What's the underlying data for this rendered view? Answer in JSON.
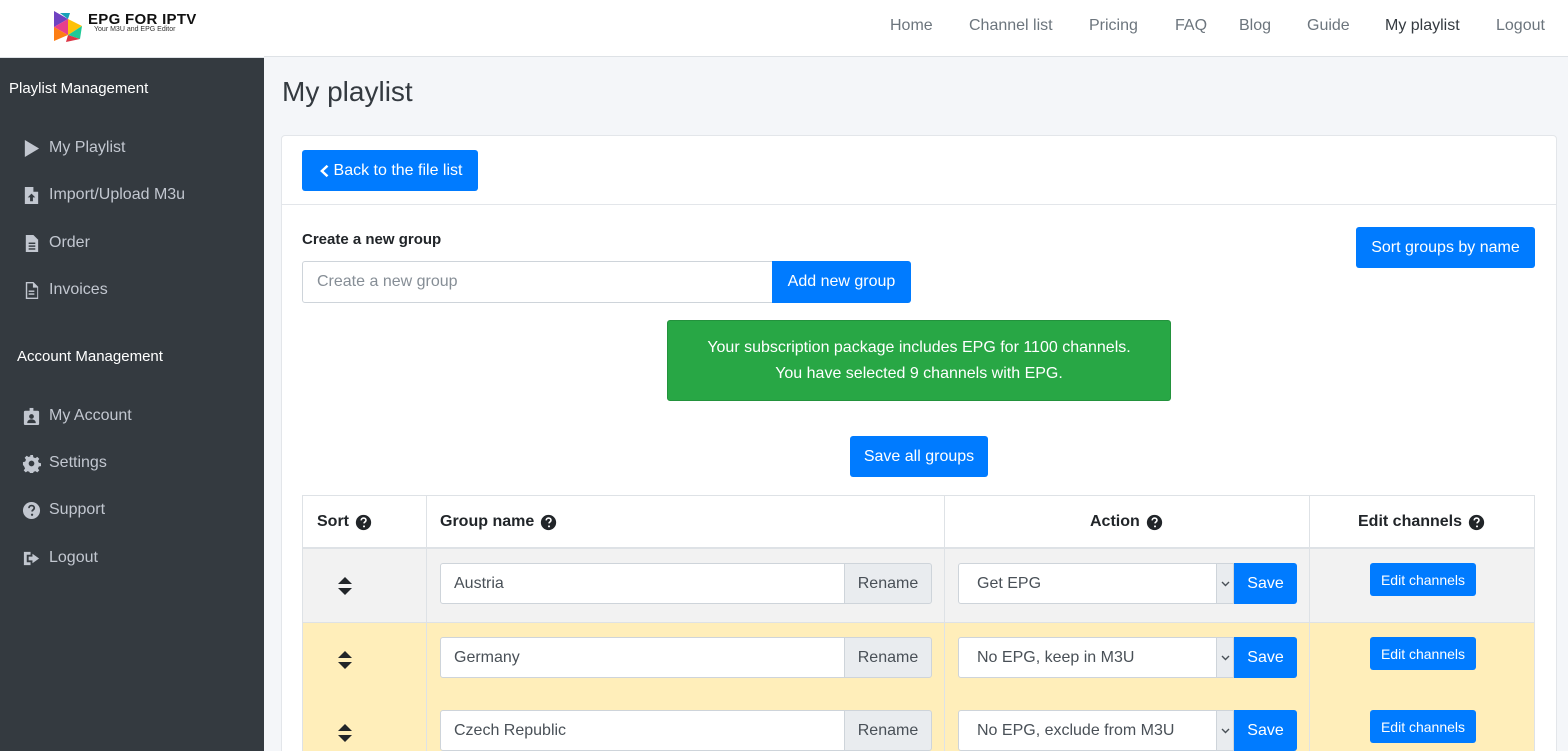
{
  "brand": {
    "title": "EPG FOR IPTV",
    "subtitle": "Your M3U and EPG Editor"
  },
  "topnav": {
    "items": [
      {
        "label": "Home"
      },
      {
        "label": "Channel list"
      },
      {
        "label": "Pricing"
      },
      {
        "label": "FAQ"
      },
      {
        "label": "Blog"
      },
      {
        "label": "Guide"
      },
      {
        "label": "My playlist",
        "active": true
      },
      {
        "label": "Logout"
      }
    ]
  },
  "sidebar": {
    "playlist_header": "Playlist Management",
    "account_header": "Account Management",
    "items": [
      {
        "label": "My Playlist",
        "icon": "play-icon"
      },
      {
        "label": "Import/Upload M3u",
        "icon": "file-upload-icon"
      },
      {
        "label": "Order",
        "icon": "file-text-icon"
      },
      {
        "label": "Invoices",
        "icon": "file-invoice-icon"
      },
      {
        "label": "My Account",
        "icon": "id-badge-icon"
      },
      {
        "label": "Settings",
        "icon": "gear-icon"
      },
      {
        "label": "Support",
        "icon": "question-circle-icon"
      },
      {
        "label": "Logout",
        "icon": "sign-out-icon"
      }
    ]
  },
  "page": {
    "title": "My playlist",
    "back_button": "Back to the file list",
    "create_group_label": "Create a new group",
    "create_group_placeholder": "Create a new group",
    "add_group_button": "Add new group",
    "sort_groups_button": "Sort groups by name",
    "alert_line1": "Your subscription package includes EPG for 1100 channels.",
    "alert_line2": "You have selected 9 channels with EPG.",
    "save_all_button": "Save all groups"
  },
  "table": {
    "headers": {
      "sort": "Sort",
      "group_name": "Group name",
      "action": "Action",
      "edit_channels": "Edit channels"
    },
    "rows": [
      {
        "group": "Austria",
        "rename": "Rename",
        "action": "Get EPG",
        "save": "Save",
        "edit": "Edit channels",
        "bg": "grey"
      },
      {
        "group": "Germany",
        "rename": "Rename",
        "action": "No EPG, keep in M3U",
        "save": "Save",
        "edit": "Edit channels",
        "bg": "yellow"
      },
      {
        "group": "Czech Republic",
        "rename": "Rename",
        "action": "No EPG, exclude from M3U",
        "save": "Save",
        "edit": "Edit channels",
        "bg": "yellow"
      }
    ]
  },
  "colors": {
    "primary": "#007bff",
    "success": "#28a745",
    "sidebar_bg": "#343a40",
    "row_warning": "#ffeeba",
    "row_grey": "#f2f2f2"
  }
}
